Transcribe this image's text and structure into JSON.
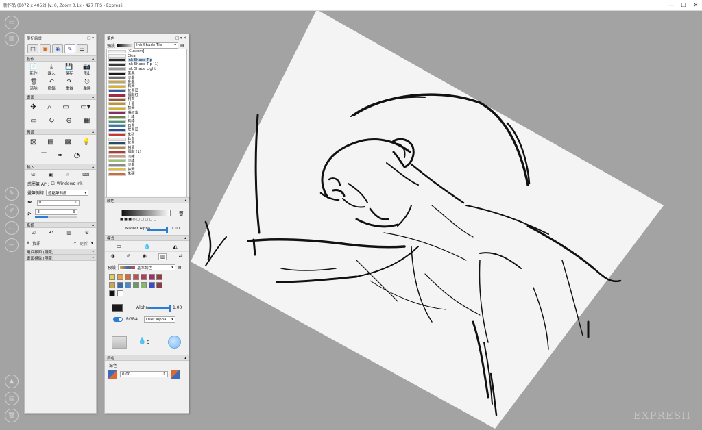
{
  "window": {
    "title": "新作品 (8072 x 4052) (v: 0, Zoom 0.1x - 427 FPS - Expresii",
    "minimize": "—",
    "maximize": "☐",
    "close": "✕"
  },
  "left_panel": {
    "title": "墨記繪畫",
    "tabs": [
      "□",
      "▣",
      "◉",
      "✎",
      "☰"
    ],
    "sections": {
      "actions": {
        "title": "動作",
        "row1": [
          {
            "icon": "📄",
            "label": "新作"
          },
          {
            "icon": "⤓",
            "label": "載入"
          },
          {
            "icon": "💾",
            "label": "保存"
          },
          {
            "icon": "📷",
            "label": "匯出"
          }
        ],
        "row2": [
          {
            "icon": "🗑",
            "label": "清除"
          },
          {
            "icon": "↶",
            "label": "撤銷"
          },
          {
            "icon": "↷",
            "label": "重做"
          },
          {
            "icon": "⎋",
            "label": "離開"
          }
        ]
      },
      "view": {
        "title": "畫面"
      },
      "tools": {
        "title": "預設"
      },
      "input": {
        "title": "輸入",
        "api_label": "感壓筆 API:",
        "api_option": "Windows Ink",
        "mapping_label": "畫筆側線",
        "mapping_value": "感壓筆斜度",
        "value1": "0",
        "value2": "3"
      },
      "system": {
        "title": "系統",
        "info": "資訊",
        "update": "更新"
      },
      "user_interface": "用戶界面 (隱藏)",
      "canvas_display": "畫面視像 (隱藏)"
    }
  },
  "right_panel": {
    "title": "筆色",
    "preset_label": "預設",
    "preset_value": "Ink Shade Tip",
    "brushes": [
      {
        "name": "[Custom]",
        "color": "#eeeeee"
      },
      {
        "name": "Clear",
        "color": "#f4f4f4"
      },
      {
        "name": "Ink Shade Tip",
        "color": "#2a2a2a",
        "selected": true
      },
      {
        "name": "Ink Shade Tip (1)",
        "color": "#3a3a3a"
      },
      {
        "name": "Ink Shade Light",
        "color": "#9a9a9a"
      },
      {
        "name": "墨黑",
        "color": "#1b1b1b"
      },
      {
        "name": "淡墨",
        "color": "#6b6b6b"
      },
      {
        "name": "金墨",
        "color": "#c9a64a"
      },
      {
        "name": "石黃",
        "color": "#d8b33a"
      },
      {
        "name": "花青藍",
        "color": "#3a5a9a"
      },
      {
        "name": "胭脂紅",
        "color": "#a2294a"
      },
      {
        "name": "赭石",
        "color": "#9a5a2a"
      },
      {
        "name": "土黃",
        "color": "#c1922f"
      },
      {
        "name": "藤黃",
        "color": "#d8b021"
      },
      {
        "name": "曙紅紫",
        "color": "#8b2a6a"
      },
      {
        "name": "汁綠",
        "color": "#6a8a3a"
      },
      {
        "name": "石綠",
        "color": "#4a9a7a"
      },
      {
        "name": "石青",
        "color": "#3a7aa8"
      },
      {
        "name": "群青藍",
        "color": "#2a4a9a"
      },
      {
        "name": "朱砂",
        "color": "#c83a2a"
      },
      {
        "name": "鈦白",
        "color": "#e8e8e8"
      },
      {
        "name": "花青",
        "color": "#2a4a6a"
      },
      {
        "name": "赭黃",
        "color": "#b88a3a"
      },
      {
        "name": "胭脂 (1)",
        "color": "#b2394a"
      },
      {
        "name": "淡赭",
        "color": "#c8a27a"
      },
      {
        "name": "淡綠",
        "color": "#9ac27a"
      },
      {
        "name": "淡墨",
        "color": "#8a8a8a"
      },
      {
        "name": "藤黃",
        "color": "#e0c040"
      },
      {
        "name": "朱磦",
        "color": "#d06a3a"
      }
    ]
  },
  "color_panel": {
    "title": "顏色",
    "master_alpha_label": "Master Alpha",
    "master_alpha_value": "1.00",
    "mode_title": "模式",
    "preset_label": "預設",
    "preset_value": "基本調色",
    "swatches_row1": [
      "#e8d04a",
      "#e8a23a",
      "#d86a3a",
      "#c84a4a",
      "#b83a5a",
      "#a82a6a",
      "#9a3a3a"
    ],
    "swatches_row2": [
      "#c8a84a",
      "#3a6aa8",
      "#4a8ac8",
      "#6a9a6a",
      "#8ab86a",
      "#3a4ac8",
      "#8a3a4a"
    ],
    "swatches_row3": [
      "#111111",
      "#ffffff"
    ],
    "alpha_label": "Alpha",
    "alpha_value": "1.00",
    "rgba_label": "RGBA",
    "user_alpha": "User alpha",
    "drop_value": "9",
    "adjust_title": "調色",
    "deep_label": "深色",
    "deep_value": "0.00"
  },
  "logo": "EXPRESII"
}
